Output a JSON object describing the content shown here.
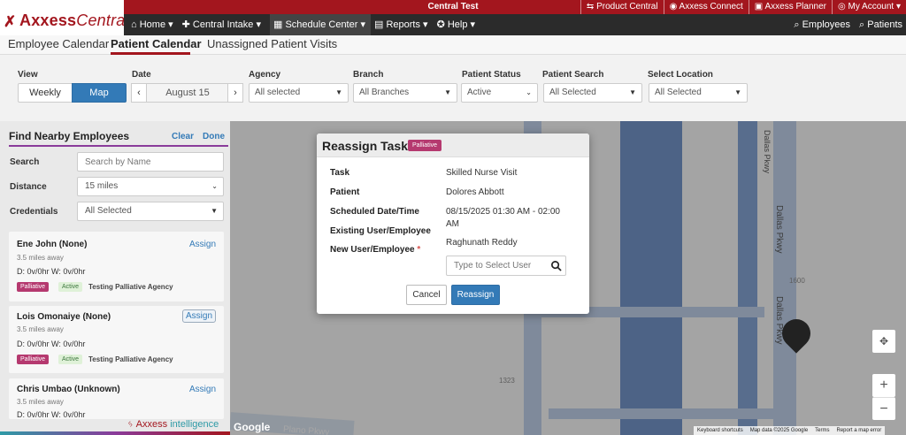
{
  "app": {
    "env_title": "Central Test",
    "logo_primary": "Axxess",
    "logo_secondary": "Central"
  },
  "top_links": [
    {
      "icon": "swap-icon",
      "label": "Product Central"
    },
    {
      "icon": "connect-icon",
      "label": "Axxess Connect"
    },
    {
      "icon": "planner-icon",
      "label": "Axxess Planner"
    },
    {
      "icon": "user-icon",
      "label": "My Account"
    }
  ],
  "nav": {
    "items": [
      {
        "icon": "home-icon",
        "label": "Home"
      },
      {
        "icon": "user-plus-icon",
        "label": "Central Intake"
      },
      {
        "icon": "calendar-icon",
        "label": "Schedule Center"
      },
      {
        "icon": "report-icon",
        "label": "Reports"
      },
      {
        "icon": "help-icon",
        "label": "Help"
      }
    ],
    "right": [
      {
        "icon": "search-icon",
        "label": "Employees"
      },
      {
        "icon": "search-icon",
        "label": "Patients"
      }
    ]
  },
  "tabs": {
    "employee_calendar": "Employee Calendar",
    "patient_calendar": "Patient Calendar",
    "unassigned": "Unassigned Patient Visits",
    "active": "Patient Calendar"
  },
  "filters": {
    "view_label": "View",
    "view_weekly": "Weekly",
    "view_map": "Map",
    "date_label": "Date",
    "date_value": "August 15",
    "agency_label": "Agency",
    "agency_value": "All selected",
    "branch_label": "Branch",
    "branch_value": "All Branches",
    "status_label": "Patient Status",
    "status_value": "Active",
    "patient_search_label": "Patient Search",
    "patient_search_value": "All Selected",
    "location_label": "Select Location",
    "location_value": "All Selected"
  },
  "panel": {
    "title": "Find Nearby Employees",
    "clear": "Clear",
    "done": "Done",
    "search_label": "Search",
    "search_placeholder": "Search by Name",
    "distance_label": "Distance",
    "distance_value": "15 miles",
    "credentials_label": "Credentials",
    "credentials_value": "All Selected",
    "employees": [
      {
        "name": "Ene John (None)",
        "assign": "Assign",
        "distance": "3.5 miles away",
        "hours": "D: 0v/0hr W: 0v/0hr",
        "badge_type": "Palliative",
        "badge_status": "Active",
        "agency": "Testing Palliative Agency"
      },
      {
        "name": "Lois Omonaiye (None)",
        "assign": "Assign",
        "distance": "3.5 miles away",
        "hours": "D: 0v/0hr W: 0v/0hr",
        "badge_type": "Palliative",
        "badge_status": "Active",
        "agency": "Testing Palliative Agency"
      },
      {
        "name": "Chris Umbao (Unknown)",
        "assign": "Assign",
        "distance": "3.5 miles away",
        "hours": "D: 0v/0hr W: 0v/0hr"
      }
    ],
    "brand_part1": "Axxess",
    "brand_part2": "intelligence"
  },
  "map": {
    "labels": [
      "Dallas Pkwy",
      "Dallas Pkwy",
      "Dallas Pkwy",
      "1600",
      "1323",
      "Plano Pkwy"
    ],
    "google": "Google",
    "footer": [
      "Keyboard shortcuts",
      "Map data ©2025 Google",
      "Terms",
      "Report a map error"
    ],
    "zoom_in": "+",
    "zoom_out": "−"
  },
  "modal": {
    "title": "Reassign Task",
    "badge": "Palliative",
    "task_label": "Task",
    "task_value": "Skilled Nurse Visit",
    "patient_label": "Patient",
    "patient_value": "Dolores Abbott",
    "scheduled_label": "Scheduled Date/Time",
    "scheduled_value_line1": "08/15/2025 01:30 AM - 02:00",
    "scheduled_value_line2": "AM",
    "existing_label": "Existing User/Employee",
    "existing_value": "Raghunath Reddy",
    "new_label": "New User/Employee",
    "new_placeholder": "Type to Select User",
    "cancel": "Cancel",
    "reassign": "Reassign"
  },
  "colors": {
    "brand_red": "#a3161e",
    "primary_blue": "#337ab7",
    "palliative": "#b5396f",
    "active_badge_bg": "#dff1d8",
    "nav_dark": "#2b2b2b"
  }
}
